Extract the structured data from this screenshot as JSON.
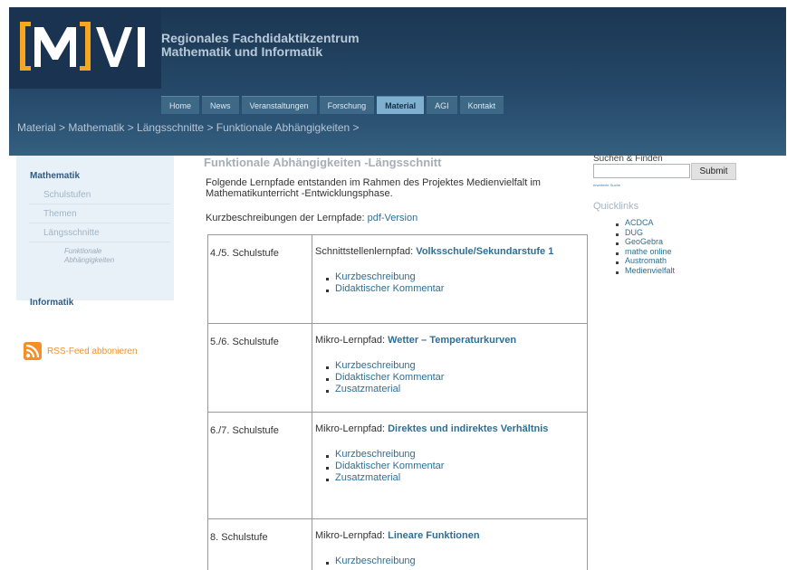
{
  "header": {
    "title_line1": "Regionales Fachdidaktikzentrum",
    "title_line2": "Mathematik und Informatik"
  },
  "nav": {
    "items": [
      "Home",
      "News",
      "Veranstaltungen",
      "Forschung",
      "Material",
      "AGI",
      "Kontakt"
    ],
    "active": "Material"
  },
  "breadcrumb": "Material > Mathematik > Längsschnitte > Funktionale Abhängigkeiten >",
  "sidebar": {
    "mathematik": "Mathematik",
    "items": [
      "Schulstufen",
      "Themen",
      "Längsschnitte"
    ],
    "sub_line1": "Funktionale",
    "sub_line2": "Abhängigkeiten",
    "informatik": "Informatik",
    "rss": "RSS-Feed abbonieren"
  },
  "content": {
    "title": "Funktionale Abhängigkeiten -Längsschnitt",
    "intro": "Folgende Lernpfade entstanden im Rahmen des Projektes Medienvielfalt im Mathematikunterricht -Entwicklungsphase.",
    "downloads_label": "Kurzbeschreibungen der Lernpfade: ",
    "downloads_link": "pdf-Version"
  },
  "table": {
    "rows": [
      {
        "level": "4./5. Schulstufe",
        "prefix": "Schnittstellenlernpfad: ",
        "title": "Volksschule/Sekundarstufe 1",
        "links": [
          "Kurzbeschreibung",
          "Didaktischer Kommentar"
        ]
      },
      {
        "level": "5./6. Schulstufe",
        "prefix": "Mikro-Lernpfad: ",
        "title": "Wetter – Temperaturkurven",
        "links": [
          "Kurzbeschreibung",
          "Didaktischer Kommentar",
          "Zusatzmaterial"
        ]
      },
      {
        "level": "6./7. Schulstufe",
        "prefix": "Mikro-Lernpfad: ",
        "title": "Direktes und indirektes Verhältnis",
        "links": [
          "Kurzbeschreibung",
          "Didaktischer Kommentar",
          "Zusatzmaterial"
        ]
      },
      {
        "level": "8. Schulstufe",
        "prefix": "Mikro-Lernpfad: ",
        "title": "Lineare Funktionen",
        "links": [
          "Kurzbeschreibung"
        ]
      }
    ]
  },
  "search": {
    "label": "Suchen & Finden",
    "button": "Submit",
    "advanced": "erweiterte Suche"
  },
  "quicklinks": {
    "title": "Quicklinks",
    "items": [
      "ACDCA",
      "DUG",
      "GeoGebra",
      "mathe online",
      "Austromath",
      "Medienvielfalt"
    ]
  },
  "colors": {
    "header_dark": "#1b3652",
    "header_light": "#35607f",
    "logo_orange": "#f5a623",
    "link": "#2e6f95",
    "rss_orange": "#f3902a"
  }
}
